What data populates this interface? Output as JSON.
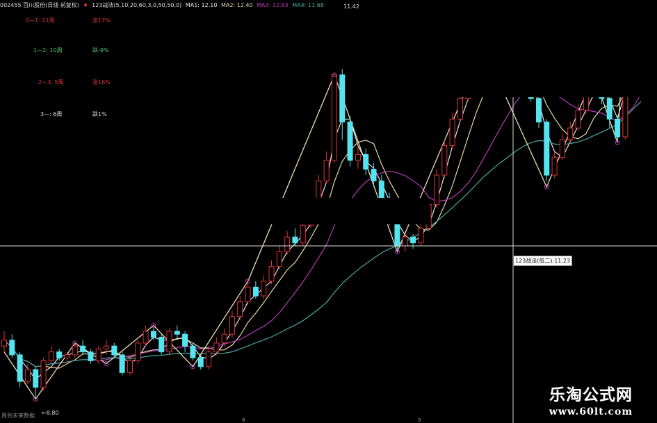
{
  "header": {
    "stock": "002455 百川股份(日线 前复权)",
    "indicator": "123战法(5,10,20,60,3,0,50,50,0)",
    "ma1": "MA1: 12.10",
    "ma2": "MA2: 12.40",
    "ma3": "MA3: 12.83",
    "ma4": "MA4: 11.68",
    "price_right": "11.42"
  },
  "stats": [
    {
      "leg": "0—1: 11周",
      "change": "涨17%",
      "color": "#e0333a"
    },
    {
      "leg": "1—2: 10周",
      "change": "跌-9%",
      "color": "#4fc36a"
    },
    {
      "leg": "2—3: 5周",
      "change": "涨16%",
      "color": "#e0333a"
    },
    {
      "leg": "3—: 6周",
      "change": "跌1%",
      "color": "#dddddd"
    }
  ],
  "tooltip": "123战法(低二):11.23",
  "footer": "周到未来数据",
  "low_label": "8.80",
  "xticks": [
    "8",
    "9"
  ],
  "watermark": {
    "title": "乐淘公式网",
    "url": "www.60lt.com"
  },
  "colors": {
    "up": "#e0333a",
    "down": "#54e4f0",
    "ma_white": "#e8e8e8",
    "ma_yellow": "#e8d9a8",
    "ma_purple": "#b43ab4",
    "ma_teal": "#4aa8a0",
    "zigzag": "#efe0b8"
  },
  "chart_data": {
    "type": "candlestick",
    "ylim": [
      8.5,
      15.5
    ],
    "candles": [
      [
        9.7,
        9.8,
        9.6,
        9.95
      ],
      [
        9.8,
        9.55,
        9.5,
        9.9
      ],
      [
        9.55,
        9.1,
        9.0,
        9.6
      ],
      [
        9.1,
        9.3,
        9.05,
        9.4
      ],
      [
        9.3,
        9.0,
        8.8,
        9.35
      ],
      [
        9.0,
        9.45,
        8.95,
        9.5
      ],
      [
        9.45,
        9.6,
        9.4,
        9.7
      ],
      [
        9.6,
        9.5,
        9.45,
        9.65
      ],
      [
        9.5,
        9.55,
        9.4,
        9.6
      ],
      [
        9.55,
        9.7,
        9.5,
        9.75
      ],
      [
        9.7,
        9.6,
        9.55,
        9.8
      ],
      [
        9.6,
        9.45,
        9.4,
        9.65
      ],
      [
        9.45,
        9.65,
        9.4,
        9.7
      ],
      [
        9.65,
        9.7,
        9.55,
        9.8
      ],
      [
        9.7,
        9.55,
        9.5,
        9.75
      ],
      [
        9.55,
        9.25,
        9.2,
        9.6
      ],
      [
        9.25,
        9.45,
        9.2,
        9.5
      ],
      [
        9.45,
        9.75,
        9.4,
        9.8
      ],
      [
        9.75,
        9.95,
        9.7,
        10.05
      ],
      [
        9.95,
        9.85,
        9.8,
        10.0
      ],
      [
        9.85,
        9.6,
        9.55,
        9.9
      ],
      [
        9.6,
        9.95,
        9.55,
        10.0
      ],
      [
        9.95,
        9.9,
        9.85,
        10.05
      ],
      [
        9.9,
        9.7,
        9.6,
        9.95
      ],
      [
        9.7,
        9.5,
        9.45,
        9.75
      ],
      [
        9.5,
        9.35,
        9.3,
        9.55
      ],
      [
        9.35,
        9.6,
        9.3,
        9.7
      ],
      [
        9.6,
        9.75,
        9.55,
        9.85
      ],
      [
        9.75,
        9.9,
        9.7,
        10.0
      ],
      [
        9.9,
        10.2,
        9.85,
        10.3
      ],
      [
        10.2,
        10.45,
        10.15,
        10.55
      ],
      [
        10.45,
        10.7,
        10.4,
        10.8
      ],
      [
        10.7,
        10.55,
        10.5,
        10.8
      ],
      [
        10.55,
        10.8,
        10.5,
        10.9
      ],
      [
        10.8,
        11.05,
        10.75,
        11.15
      ],
      [
        11.05,
        11.3,
        11.0,
        11.4
      ],
      [
        11.3,
        11.55,
        11.25,
        11.65
      ],
      [
        11.55,
        11.45,
        11.4,
        11.7
      ],
      [
        11.45,
        11.75,
        11.4,
        11.85
      ],
      [
        11.75,
        12.1,
        11.7,
        12.2
      ],
      [
        12.1,
        12.5,
        12.05,
        12.6
      ],
      [
        12.5,
        12.85,
        12.45,
        13.0
      ],
      [
        12.85,
        14.3,
        12.8,
        14.3
      ],
      [
        14.3,
        13.5,
        13.2,
        14.4
      ],
      [
        13.5,
        12.85,
        12.75,
        13.6
      ],
      [
        12.85,
        12.95,
        12.7,
        13.1
      ],
      [
        12.95,
        12.7,
        12.6,
        13.05
      ],
      [
        12.7,
        12.5,
        12.4,
        12.8
      ],
      [
        12.5,
        12.2,
        12.15,
        12.6
      ],
      [
        12.2,
        11.8,
        11.75,
        12.3
      ],
      [
        11.8,
        11.4,
        11.3,
        11.9
      ],
      [
        11.4,
        11.55,
        11.3,
        11.6
      ],
      [
        11.55,
        11.45,
        11.35,
        11.6
      ],
      [
        11.45,
        11.7,
        11.4,
        11.8
      ],
      [
        11.7,
        12.1,
        11.65,
        12.2
      ],
      [
        12.1,
        12.6,
        12.05,
        12.7
      ],
      [
        12.6,
        13.1,
        12.55,
        13.2
      ],
      [
        13.1,
        13.55,
        13.05,
        13.65
      ],
      [
        13.55,
        13.9,
        13.5,
        14.05
      ],
      [
        13.9,
        14.2,
        13.85,
        14.35
      ],
      [
        14.2,
        14.5,
        14.15,
        14.65
      ],
      [
        14.5,
        14.6,
        14.4,
        14.75
      ],
      [
        14.6,
        14.3,
        14.2,
        14.7
      ],
      [
        14.3,
        14.45,
        14.2,
        14.55
      ],
      [
        14.45,
        14.25,
        14.15,
        14.55
      ],
      [
        14.25,
        14.35,
        14.15,
        14.45
      ],
      [
        14.35,
        14.15,
        14.05,
        14.4
      ],
      [
        14.15,
        13.9,
        13.85,
        14.2
      ],
      [
        13.9,
        13.5,
        13.4,
        13.95
      ],
      [
        13.5,
        12.6,
        12.5,
        13.55
      ],
      [
        12.6,
        12.9,
        12.55,
        13.0
      ],
      [
        12.9,
        13.2,
        12.85,
        13.3
      ],
      [
        13.2,
        13.4,
        13.15,
        13.5
      ],
      [
        13.4,
        13.7,
        13.35,
        13.8
      ],
      [
        13.7,
        14.0,
        13.65,
        14.15
      ],
      [
        14.0,
        14.2,
        13.95,
        14.3
      ],
      [
        14.2,
        13.9,
        13.8,
        14.25
      ],
      [
        13.9,
        13.55,
        13.4,
        13.95
      ],
      [
        13.55,
        13.25,
        13.15,
        13.6
      ],
      [
        13.25,
        15.2,
        13.2,
        15.3
      ],
      [
        15.2,
        15.1,
        14.9,
        15.4
      ],
      [
        15.1,
        15.3,
        15.0,
        15.45
      ]
    ],
    "zigzag": [
      [
        0,
        9.6
      ],
      [
        4,
        8.8
      ],
      [
        9,
        9.75
      ],
      [
        13,
        9.4
      ],
      [
        19,
        10.05
      ],
      [
        24,
        9.35
      ],
      [
        31,
        10.8
      ],
      [
        42,
        14.3
      ],
      [
        50,
        11.3
      ],
      [
        61,
        14.75
      ],
      [
        69,
        12.4
      ],
      [
        75,
        14.3
      ],
      [
        78,
        13.15
      ],
      [
        79,
        15.4
      ]
    ]
  }
}
